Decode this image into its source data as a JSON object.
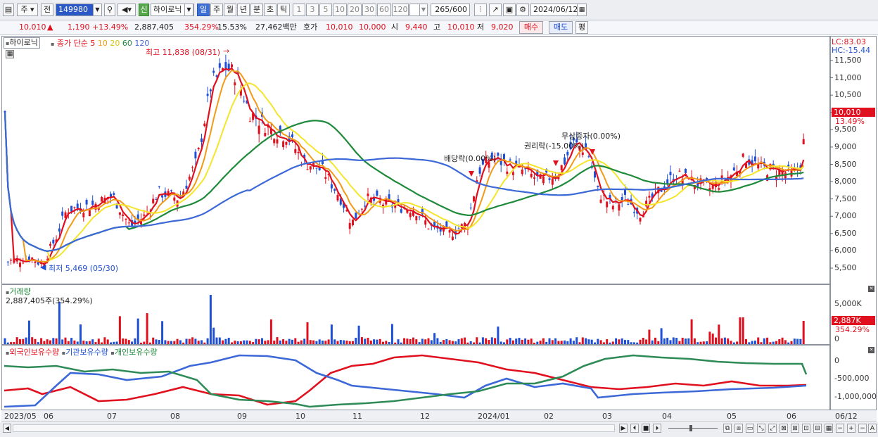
{
  "toolbar": {
    "market_type": "주",
    "full_label": "전",
    "code": "149980",
    "search_icon": "search-icon",
    "sound_icon": "speaker-icon",
    "new_badge": "신",
    "stock_name": "하이로닉",
    "period_buttons": [
      "일",
      "주",
      "월",
      "년",
      "분",
      "초",
      "틱"
    ],
    "active_period": "일",
    "interval_buttons": [
      "1",
      "3",
      "5",
      "10",
      "20",
      "30",
      "60",
      "120"
    ],
    "count": "265",
    "count_total": "/600",
    "date": "2024/06/12"
  },
  "quote": {
    "price": "10,010",
    "change": "1,190",
    "change_pct": "+13.49%",
    "volume": "2,887,405",
    "volume_pct": "354.29%",
    "turnover": "15.53%",
    "amount": "27,462백만",
    "bid_label": "호가",
    "ask_price": "10,010",
    "bid_price": "10,000",
    "open_label": "시",
    "open": "9,440",
    "high_label": "고",
    "high": "10,010",
    "low_label": "저",
    "low": "9,020",
    "buy_button": "매수",
    "sell_button": "매도",
    "eval_button": "평"
  },
  "price_panel": {
    "stock_label": "하이로닉",
    "ma_label": "종가 단순",
    "ma_periods": [
      "5",
      "10",
      "20",
      "60",
      "120"
    ],
    "ma_colors": [
      "#e0101e",
      "#f29a18",
      "#f5e52a",
      "#1e8a3a",
      "#3c68d8"
    ],
    "lc_label": "LC:83.03",
    "hc_label": "HC:-15.44",
    "high_marker": "최고 11,838 (08/31)",
    "low_marker": "최저 5,469 (05/30)",
    "dividend_marker": "배당락(0.00%)",
    "rights_marker": "권리락(-15.00%)",
    "bonus_marker": "무상증자(0.00%)",
    "current_price_tag": "10,010",
    "current_pct_tag": "13.49%",
    "y_ticks": [
      "11,500",
      "11,000",
      "10,500",
      "10,000",
      "9,500",
      "9,000",
      "8,500",
      "8,000",
      "7,500",
      "7,000",
      "6,500",
      "6,000",
      "5,500"
    ]
  },
  "volume_panel": {
    "title": "거래량",
    "value": "2,887,405주(354.29%)",
    "y_ticks": [
      "5,000K",
      "0"
    ],
    "current_tag": "2,887K",
    "current_pct": "354.29%"
  },
  "holding_panel": {
    "series": [
      "외국인보유수량",
      "기관보유수량",
      "개인보유수량"
    ],
    "colors": [
      "#e0101e",
      "#3c68d8",
      "#2e8b57"
    ],
    "y_ticks": [
      "0",
      "-500,000",
      "-1,000,000"
    ]
  },
  "x_axis": {
    "labels": [
      "2023/05",
      "06",
      "07",
      "08",
      "09",
      "10",
      "11",
      "12",
      "2024/01",
      "02",
      "03",
      "04",
      "05",
      "06"
    ],
    "right_label": "06/12"
  },
  "chart_data": {
    "type": "candlestick",
    "title": "하이로닉",
    "x_range": [
      "2023/05",
      "2024/06/12"
    ],
    "ylim": [
      5300,
      12000
    ],
    "y_axis_ticks": [
      5500,
      6000,
      6500,
      7000,
      7500,
      8000,
      8500,
      9000,
      9500,
      10000,
      10500,
      11000,
      11500
    ],
    "all_time_high": {
      "label": "최고",
      "value": 11838,
      "date": "08/31"
    },
    "all_time_low": {
      "label": "최저",
      "value": 5469,
      "date": "05/30"
    },
    "last_close": 10010,
    "approx_close_by_month": [
      {
        "month": "2023/05",
        "close": 5700
      },
      {
        "month": "06",
        "close": 7200
      },
      {
        "month": "07",
        "close": 6700
      },
      {
        "month": "08",
        "close": 10500
      },
      {
        "month": "09",
        "close": 9700
      },
      {
        "month": "10",
        "close": 8200
      },
      {
        "month": "11",
        "close": 7200
      },
      {
        "month": "12",
        "close": 6700
      },
      {
        "month": "2024/01",
        "close": 8600
      },
      {
        "month": "02",
        "close": 8400
      },
      {
        "month": "03",
        "close": 7200
      },
      {
        "month": "04",
        "close": 8000
      },
      {
        "month": "05",
        "close": 8300
      },
      {
        "month": "06",
        "close": 10010
      }
    ],
    "moving_averages": [
      "5",
      "10",
      "20",
      "60",
      "120"
    ]
  }
}
